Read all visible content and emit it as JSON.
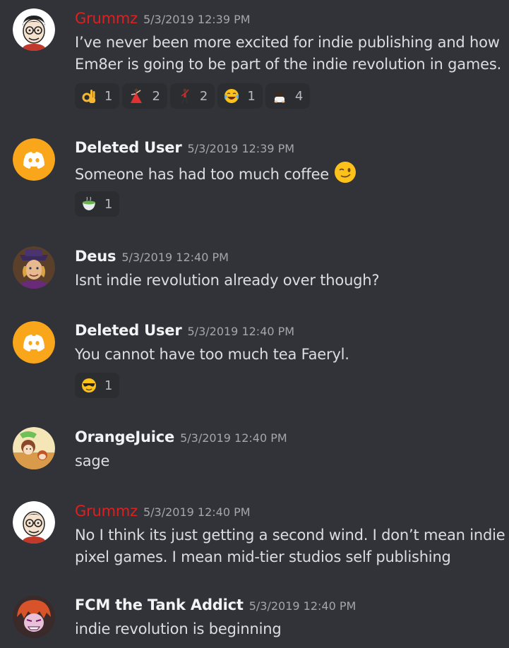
{
  "messages": [
    {
      "author": "Grummz",
      "timestamp": "5/3/2019 12:39 PM",
      "lines": [
        "I’ve never been more excited for indie publishing and how",
        "Em8er is going to be part of the indie revolution in games."
      ],
      "reactions": [
        {
          "emoji": "ok-hand-icon",
          "count": "1"
        },
        {
          "emoji": "dancer-icon",
          "count": "2"
        },
        {
          "emoji": "man-dancing-icon",
          "count": "2"
        },
        {
          "emoji": "joy-icon",
          "count": "1"
        },
        {
          "emoji": "man-bowing-icon",
          "count": "4"
        }
      ]
    },
    {
      "author": "Deleted User",
      "timestamp": "5/3/2019 12:39 PM",
      "lines": [
        "Someone has had too much coffee"
      ],
      "inline_emoji": "wink-icon",
      "reactions": [
        {
          "emoji": "tea-icon",
          "count": "1"
        }
      ]
    },
    {
      "author": "Deus",
      "timestamp": "5/3/2019 12:40 PM",
      "lines": [
        "Isnt indie revolution already over though?"
      ]
    },
    {
      "author": "Deleted User",
      "timestamp": "5/3/2019 12:40 PM",
      "lines": [
        "You cannot have too much tea Faeryl."
      ],
      "reactions": [
        {
          "emoji": "sunglasses-icon",
          "count": "1"
        }
      ]
    },
    {
      "author": "OrangeJuice",
      "timestamp": "5/3/2019 12:40 PM",
      "lines": [
        "sage"
      ]
    },
    {
      "author": "Grummz",
      "timestamp": "5/3/2019 12:40 PM",
      "lines": [
        "No I think its just getting a second wind. I don’t mean indie",
        "pixel games. I mean mid-tier studios self publishing"
      ]
    },
    {
      "author": "FCM the Tank Addict",
      "timestamp": "5/3/2019 12:40 PM",
      "lines": [
        "indie revolution is beginning"
      ]
    }
  ],
  "colors": {
    "background": "#313338",
    "reaction_bg": "#2b2d31",
    "grummz_name": "#e01f1f",
    "discord_avatar": "#faa61a"
  }
}
